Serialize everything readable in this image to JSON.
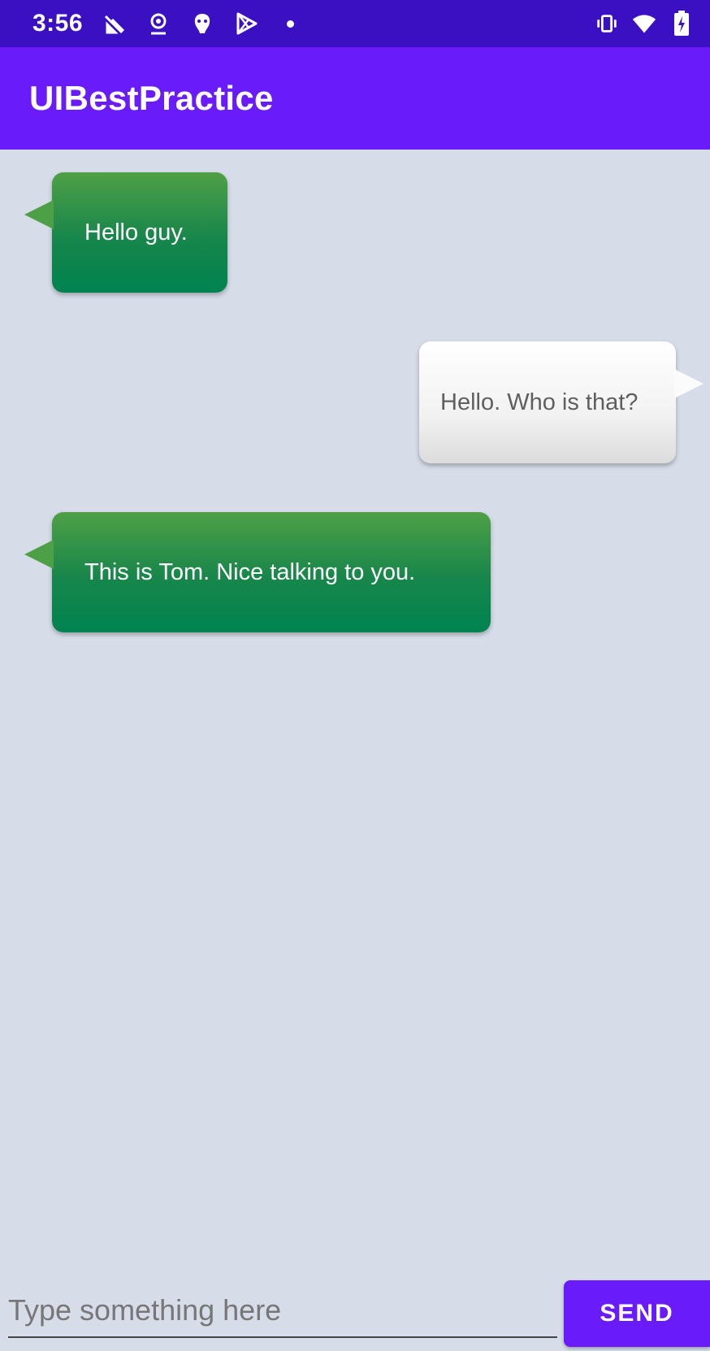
{
  "status_bar": {
    "time": "3:56",
    "left_icons": [
      "no-signal-icon",
      "location-icon",
      "notification-app-icon",
      "play-store-icon",
      "dot-icon"
    ],
    "right_icons": [
      "vibrate-icon",
      "wifi-icon",
      "battery-charging-icon"
    ]
  },
  "app_bar": {
    "title": "UIBestPractice",
    "color": "#6a1bfa"
  },
  "messages": [
    {
      "type": "received",
      "text": "Hello guy."
    },
    {
      "type": "sent",
      "text": "Hello. Who is that?"
    },
    {
      "type": "received",
      "text": "This is Tom. Nice talking to you."
    }
  ],
  "input": {
    "placeholder": "Type something here",
    "value": ""
  },
  "send_button": {
    "label": "SEND"
  },
  "colors": {
    "status_bar": "#3b0fc2",
    "accent": "#6a1bfa",
    "background": "#d6dde9",
    "received_bubble": "#17864b",
    "sent_bubble": "#f2f2f2"
  }
}
